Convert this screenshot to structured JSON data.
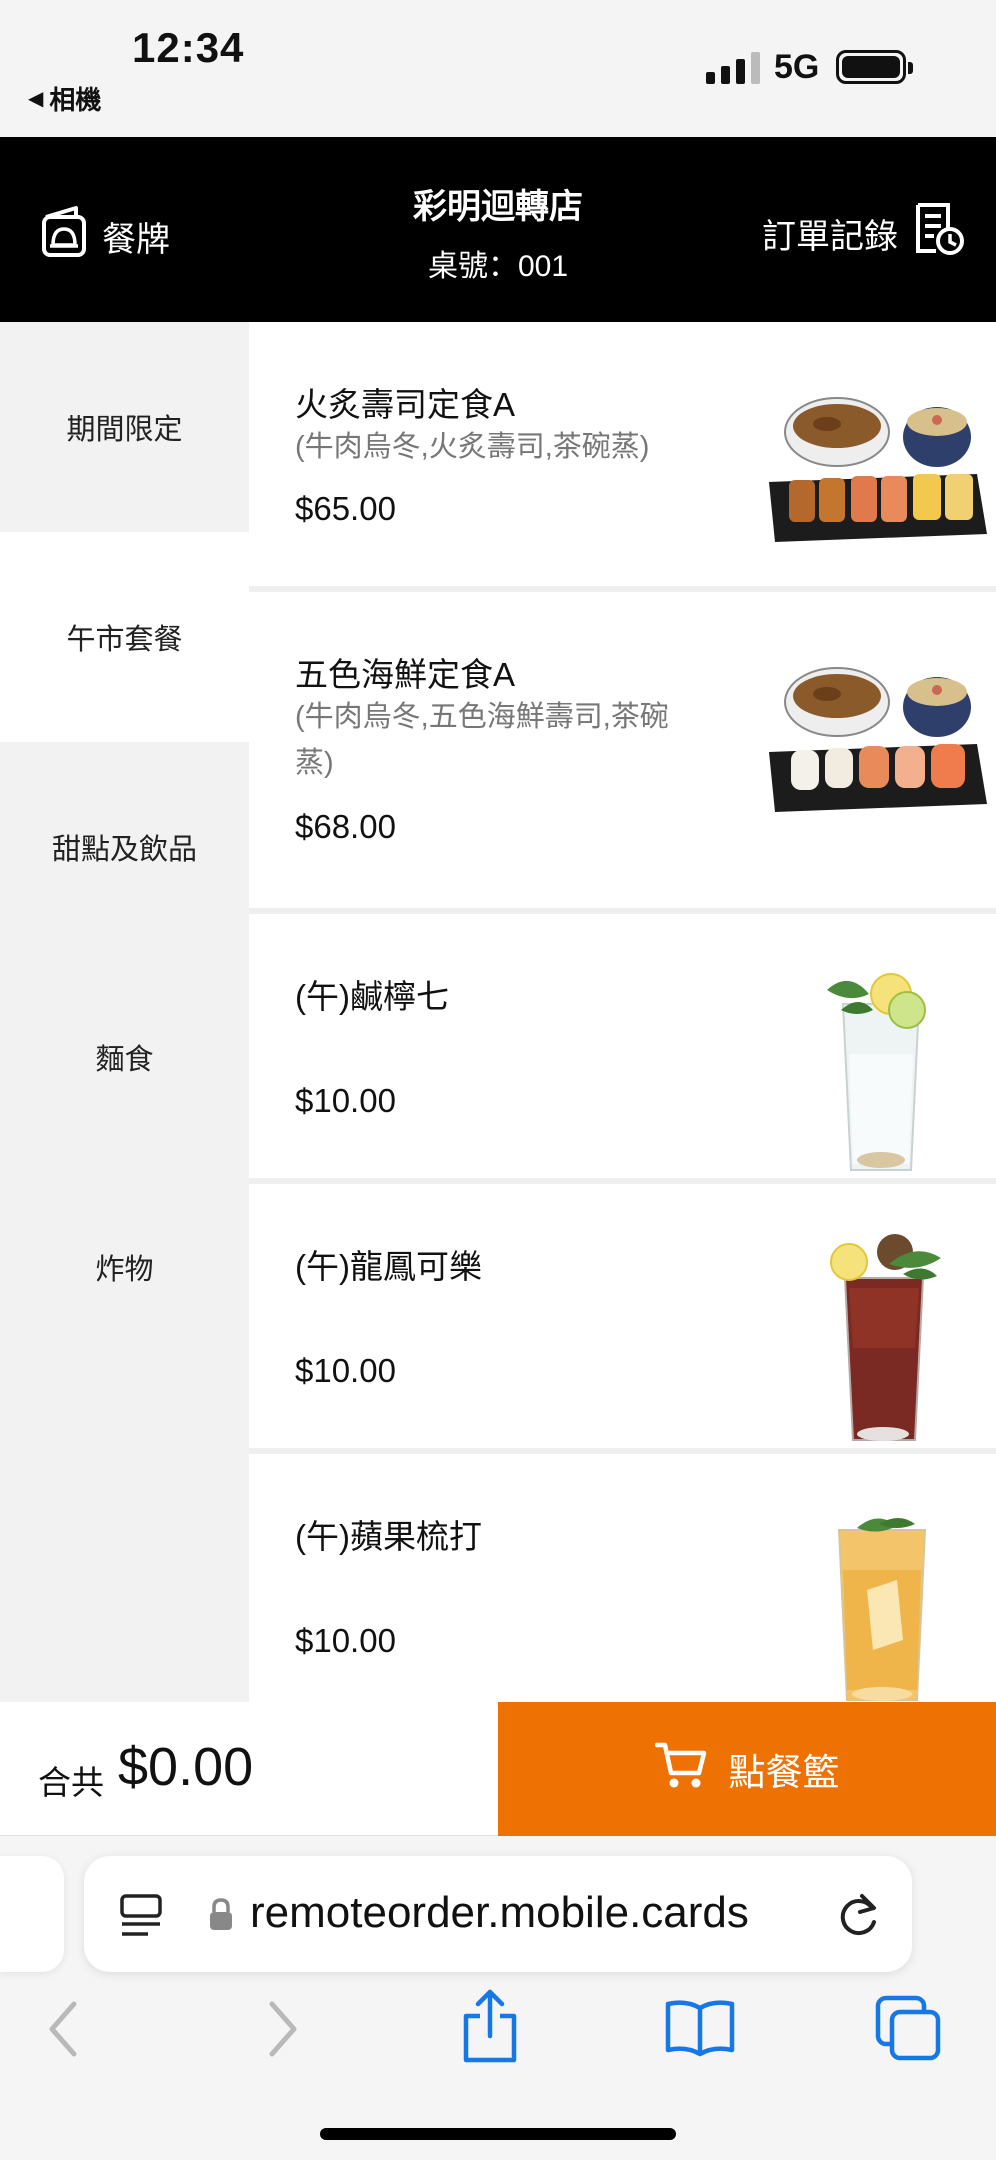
{
  "status_bar": {
    "time": "12:34",
    "back_app": "相機",
    "network": "5G"
  },
  "header": {
    "menu_label": "餐牌",
    "store_name": "彩明迴轉店",
    "table_number": "桌號：001",
    "orders_label": "訂單記錄"
  },
  "categories": [
    {
      "label": "期間限定",
      "active": false
    },
    {
      "label": "午市套餐",
      "active": true
    },
    {
      "label": "甜點及飲品",
      "active": false
    },
    {
      "label": "麵食",
      "active": false
    },
    {
      "label": "炸物",
      "active": false
    }
  ],
  "items": [
    {
      "name": "火炙壽司定食A",
      "desc": "(牛肉烏冬,火炙壽司,茶碗蒸)",
      "price": "$65.00",
      "image": "sushi-set-icon"
    },
    {
      "name": "五色海鮮定食A",
      "desc": "(牛肉烏冬,五色海鮮壽司,茶碗蒸)",
      "price": "$68.00",
      "image": "sushi-set-icon"
    },
    {
      "name": "(午)鹹檸七",
      "desc": "",
      "price": "$10.00",
      "image": "lemon-soda-icon"
    },
    {
      "name": "(午)龍鳳可樂",
      "desc": "",
      "price": "$10.00",
      "image": "cola-icon"
    },
    {
      "name": "(午)蘋果梳打",
      "desc": "",
      "price": "$10.00",
      "image": "apple-soda-icon"
    }
  ],
  "order_bar": {
    "total_label": "合共",
    "total_value": "$0.00",
    "cart_label": "點餐籃",
    "cart_color": "#ee7203"
  },
  "browser": {
    "url": "remoteorder.mobile.cards"
  }
}
